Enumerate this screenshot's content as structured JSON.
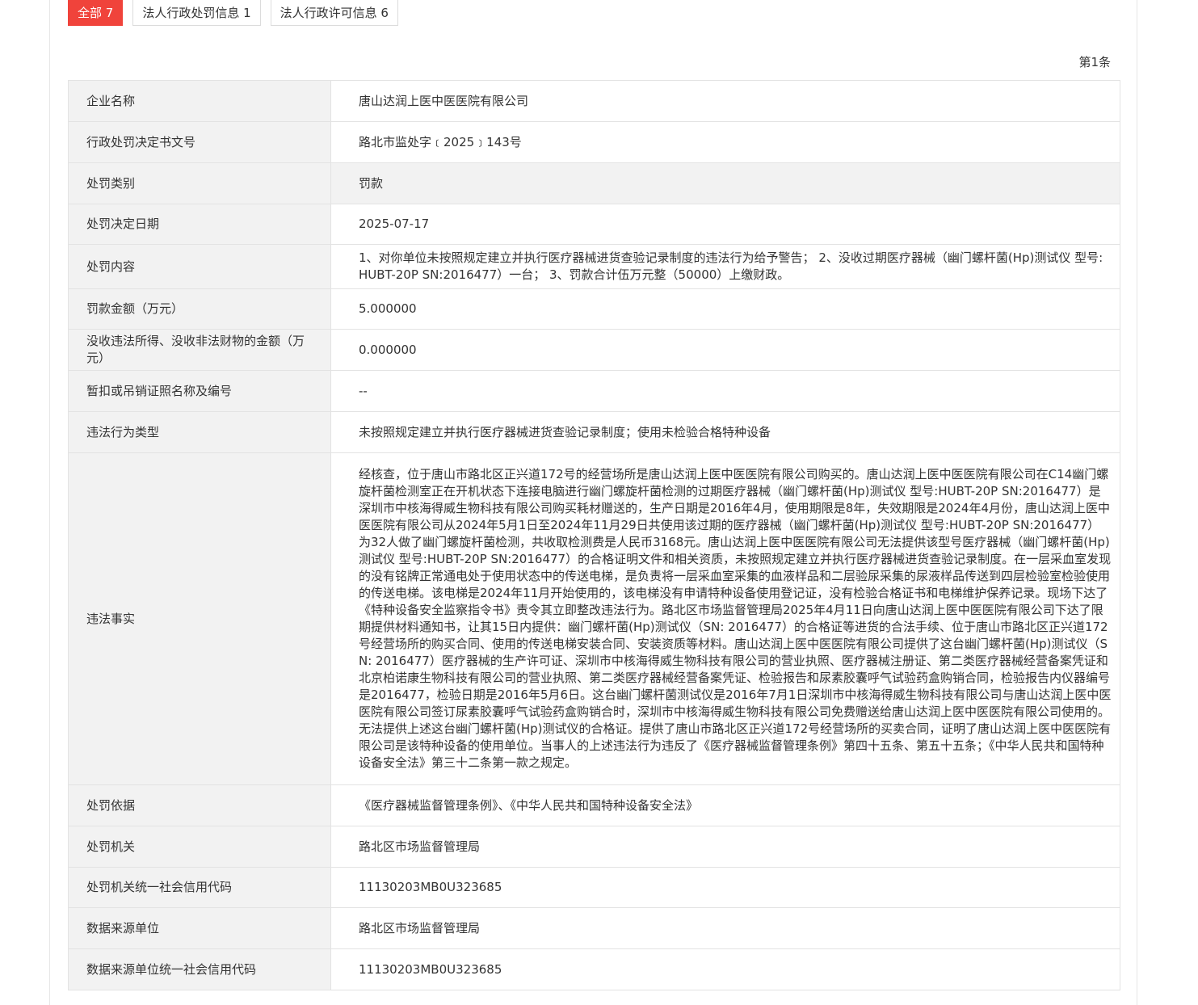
{
  "tabs": [
    {
      "label": "全部 7",
      "active": true
    },
    {
      "label": "法人行政处罚信息 1",
      "active": false
    },
    {
      "label": "法人行政许可信息 6",
      "active": false
    }
  ],
  "record_index": "第1条",
  "rows": [
    {
      "label": "企业名称",
      "value": "唐山达润上医中医医院有限公司"
    },
    {
      "label": "行政处罚决定书文号",
      "value": "路北市监处字﹝2025﹞143号"
    },
    {
      "label": "处罚类别",
      "value": "罚款"
    },
    {
      "label": "处罚决定日期",
      "value": "2025-07-17"
    },
    {
      "label": "处罚内容",
      "value": "1、对你单位未按照规定建立并执行医疗器械进货查验记录制度的违法行为给予警告； 2、没收过期医疗器械（幽门螺杆菌(Hp)测试仪 型号:HUBT-20P SN:2016477）一台； 3、罚款合计伍万元整（50000）上缴财政。"
    },
    {
      "label": "罚款金额（万元）",
      "value": "5.000000"
    },
    {
      "label": "没收违法所得、没收非法财物的金额（万元）",
      "value": "0.000000"
    },
    {
      "label": "暂扣或吊销证照名称及编号",
      "value": "--"
    },
    {
      "label": "违法行为类型",
      "value": "未按照规定建立并执行医疗器械进货查验记录制度；使用未检验合格特种设备"
    },
    {
      "label": "违法事实",
      "value": "经核查，位于唐山市路北区正兴道172号的经营场所是唐山达润上医中医医院有限公司购买的。唐山达润上医中医医院有限公司在C14幽门螺旋杆菌检测室正在开机状态下连接电脑进行幽门螺旋杆菌检测的过期医疗器械（幽门螺杆菌(Hp)测试仪 型号:HUBT-20P SN:2016477）是深圳市中核海得威生物科技有限公司购买耗材赠送的，生产日期是2016年4月，使用期限是8年，失效期限是2024年4月份，唐山达润上医中医医院有限公司从2024年5月1日至2024年11月29日共使用该过期的医疗器械（幽门螺杆菌(Hp)测试仪 型号:HUBT-20P SN:2016477）为32人做了幽门螺旋杆菌检测，共收取检测费是人民币3168元。唐山达润上医中医医院有限公司无法提供该型号医疗器械（幽门螺杆菌(Hp)测试仪 型号:HUBT-20P SN:2016477）的合格证明文件和相关资质，未按照规定建立并执行医疗器械进货查验记录制度。在一层采血室发现的没有铭牌正常通电处于使用状态中的传送电梯，是负责将一层采血室采集的血液样品和二层验尿采集的尿液样品传送到四层检验室检验使用的传送电梯。该电梯是2024年11月开始使用的，该电梯没有申请特种设备使用登记证，没有检验合格证书和电梯维护保养记录。现场下达了《特种设备安全监察指令书》责令其立即整改违法行为。路北区市场监督管理局2025年4月11日向唐山达润上医中医医院有限公司下达了限期提供材料通知书，让其15日内提供：幽门螺杆菌(Hp)测试仪（SN: 2016477）的合格证等进货的合法手续、位于唐山市路北区正兴道172号经营场所的购买合同、使用的传送电梯安装合同、安装资质等材料。唐山达润上医中医医院有限公司提供了这台幽门螺杆菌(Hp)测试仪（SN: 2016477）医疗器械的生产许可证、深圳市中核海得威生物科技有限公司的营业执照、医疗器械注册证、第二类医疗器械经营备案凭证和北京柏诺康生物科技有限公司的营业执照、第二类医疗器械经营备案凭证、检验报告和尿素胶囊呼气试验药盒购销合同，检验报告内仪器编号是2016477，检验日期是2016年5月6日。这台幽门螺杆菌测试仪是2016年7月1日深圳市中核海得威生物科技有限公司与唐山达润上医中医医院有限公司签订尿素胶囊呼气试验药盒购销合时，深圳市中核海得威生物科技有限公司免费赠送给唐山达润上医中医医院有限公司使用的。无法提供上述这台幽门螺杆菌(Hp)测试仪的合格证。提供了唐山市路北区正兴道172号经营场所的买卖合同，证明了唐山达润上医中医医院有限公司是该特种设备的使用单位。当事人的上述违法行为违反了《医疗器械监督管理条例》第四十五条、第五十五条；《中华人民共和国特种设备安全法》第三十二条第一款之规定。"
    },
    {
      "label": "处罚依据",
      "value": "《医疗器械监督管理条例》、《中华人民共和国特种设备安全法》"
    },
    {
      "label": "处罚机关",
      "value": "路北区市场监督管理局"
    },
    {
      "label": "处罚机关统一社会信用代码",
      "value": "11130203MB0U323685"
    },
    {
      "label": "数据来源单位",
      "value": "路北区市场监督管理局"
    },
    {
      "label": "数据来源单位统一社会信用代码",
      "value": "11130203MB0U323685"
    }
  ]
}
